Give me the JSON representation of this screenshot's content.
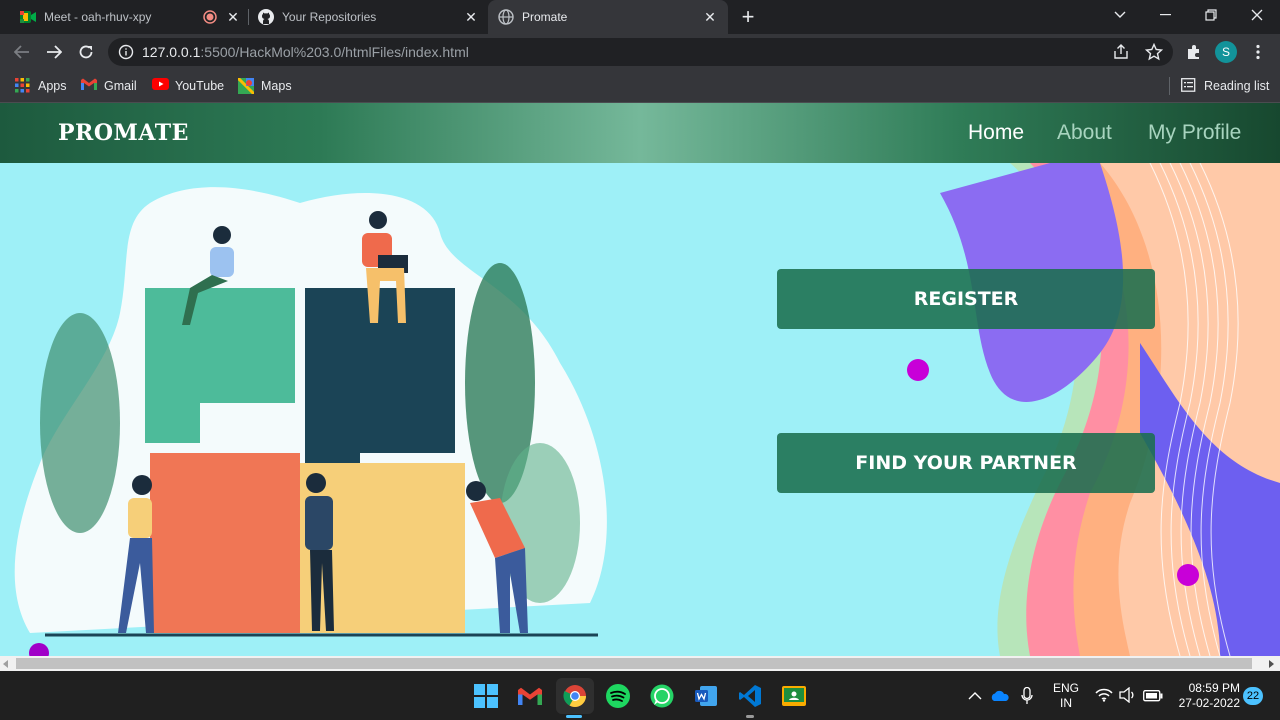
{
  "browser": {
    "tabs": [
      {
        "title": "Meet - oah-rhuv-xpy",
        "icon": "meet-icon",
        "recording": true
      },
      {
        "title": "Your Repositories",
        "icon": "github-icon"
      },
      {
        "title": "Promate",
        "icon": "globe-icon",
        "active": true
      }
    ],
    "new_tab": "+",
    "url": {
      "host": "127.0.0.1",
      "path": ":5500/HackMol%203.0/htmlFiles/index.html"
    },
    "profile_initial": "S",
    "bookmarks": [
      {
        "label": "Apps",
        "icon": "apps-grid-icon"
      },
      {
        "label": "Gmail",
        "icon": "gmail-icon"
      },
      {
        "label": "YouTube",
        "icon": "youtube-icon"
      },
      {
        "label": "Maps",
        "icon": "maps-icon"
      }
    ],
    "reading_list": "Reading list"
  },
  "site": {
    "brand": "PROMATE",
    "nav": [
      {
        "label": "Home",
        "active": true
      },
      {
        "label": "About",
        "active": false
      },
      {
        "label": "My Profile",
        "active": false
      }
    ],
    "buttons": {
      "register": "REGISTER",
      "find_partner": "FIND YOUR PARTNER"
    },
    "colors": {
      "accent": "#1b6e4e",
      "background": "#9ef0f7"
    }
  },
  "taskbar": {
    "apps": [
      "windows-start-icon",
      "gmail-icon",
      "chrome-icon",
      "spotify-icon",
      "whatsapp-icon",
      "word-icon",
      "vscode-icon",
      "classroom-icon"
    ],
    "language": "ENG",
    "region": "IN",
    "time": "08:59 PM",
    "date": "27-02-2022",
    "notifications": "22"
  }
}
